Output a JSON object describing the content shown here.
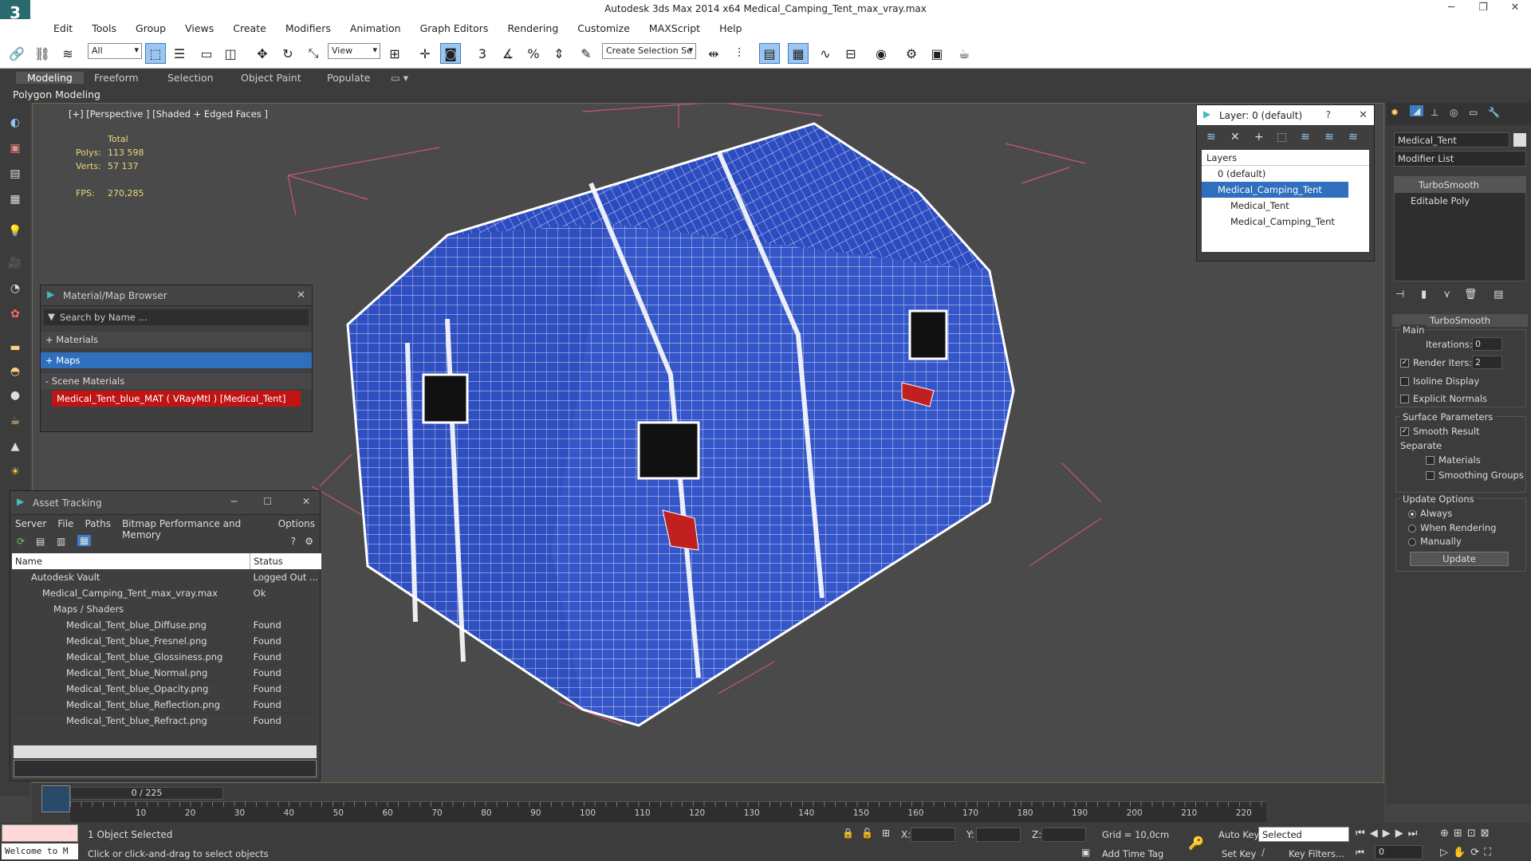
{
  "window": {
    "title": "Autodesk 3ds Max  2014 x64     Medical_Camping_Tent_max_vray.max",
    "logo": "3"
  },
  "menu": [
    "Edit",
    "Tools",
    "Group",
    "Views",
    "Create",
    "Modifiers",
    "Animation",
    "Graph Editors",
    "Rendering",
    "Customize",
    "MAXScript",
    "Help"
  ],
  "toolbar": {
    "filter": "All",
    "refcoord": "View",
    "selset": "Create Selection Se"
  },
  "ribbon": {
    "tabs": [
      "Modeling",
      "Freeform",
      "Selection",
      "Object Paint",
      "Populate"
    ],
    "sub": "Polygon Modeling"
  },
  "viewport": {
    "label": "[+] [Perspective ] [Shaded + Edged Faces ]",
    "stats": {
      "total_label": "Total",
      "polys_label": "Polys:",
      "polys": "113 598",
      "verts_label": "Verts:",
      "verts": "57 137",
      "fps_label": "FPS:",
      "fps": "270,285"
    }
  },
  "material_browser": {
    "title": "Material/Map Browser",
    "search": "Search by Name ...",
    "groups": [
      "+ Materials",
      "+ Maps",
      "- Scene Materials"
    ],
    "item": "Medical_Tent_blue_MAT  ( VRayMtl )  [Medical_Tent]"
  },
  "asset_tracking": {
    "title": "Asset Tracking",
    "menu": [
      "Server",
      "File",
      "Paths",
      "Bitmap Performance and Memory",
      "Options"
    ],
    "col_name": "Name",
    "col_status": "Status",
    "rows": [
      {
        "name": "Autodesk Vault",
        "status": "Logged Out ..."
      },
      {
        "name": "Medical_Camping_Tent_max_vray.max",
        "status": "Ok"
      },
      {
        "name": "Maps / Shaders",
        "status": ""
      },
      {
        "name": "Medical_Tent_blue_Diffuse.png",
        "status": "Found"
      },
      {
        "name": "Medical_Tent_blue_Fresnel.png",
        "status": "Found"
      },
      {
        "name": "Medical_Tent_blue_Glossiness.png",
        "status": "Found"
      },
      {
        "name": "Medical_Tent_blue_Normal.png",
        "status": "Found"
      },
      {
        "name": "Medical_Tent_blue_Opacity.png",
        "status": "Found"
      },
      {
        "name": "Medical_Tent_blue_Reflection.png",
        "status": "Found"
      },
      {
        "name": "Medical_Tent_blue_Refract.png",
        "status": "Found"
      }
    ]
  },
  "layers": {
    "title": "Layer: 0 (default)",
    "header": "Layers",
    "items": [
      "0 (default)",
      "Medical_Camping_Tent",
      "Medical_Tent",
      "Medical_Camping_Tent"
    ]
  },
  "right_panel": {
    "object_name": "Medical_Tent",
    "modifier_list": "Modifier List",
    "stack": [
      "TurboSmooth",
      "Editable Poly"
    ],
    "rollout": "TurboSmooth",
    "main": "Main",
    "iterations_label": "Iterations:",
    "iterations": "0",
    "render_iters_label": "Render Iters:",
    "render_iters": "2",
    "isoline": "Isoline Display",
    "explicit": "Explicit Normals",
    "surface": "Surface Parameters",
    "smooth_result": "Smooth Result",
    "separate": "Separate",
    "materials": "Materials",
    "smoothing": "Smoothing Groups",
    "update_options": "Update Options",
    "always": "Always",
    "when_rendering": "When Rendering",
    "manually": "Manually",
    "update": "Update"
  },
  "timeline": {
    "counter": "0 / 225",
    "ticks": [
      "10",
      "20",
      "30",
      "40",
      "50",
      "60",
      "70",
      "80",
      "90",
      "100",
      "110",
      "120",
      "130",
      "140",
      "150",
      "160",
      "170",
      "180",
      "190",
      "200",
      "210",
      "220"
    ]
  },
  "status": {
    "selected": "1 Object Selected",
    "hint": "Click or click-and-drag to select objects",
    "welcome": "Welcome to M",
    "x_label": "X:",
    "y_label": "Y:",
    "z_label": "Z:",
    "grid": "Grid = 10,0cm",
    "add_time_tag": "Add Time Tag",
    "auto_key": "Auto Key",
    "set_key": "Set Key",
    "selected_dd": "Selected",
    "key_filters": "Key Filters...",
    "frame": "0"
  },
  "colors": {
    "tent_blue": "#2f4fc0",
    "wire": "#ffffff",
    "accent": "#2f6fbd"
  }
}
